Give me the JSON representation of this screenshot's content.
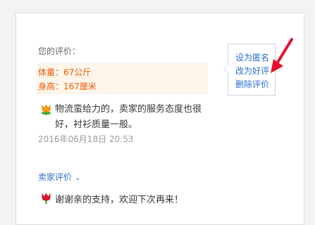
{
  "review": {
    "heading": "您的评价：",
    "attributes": [
      {
        "label": "体重：",
        "value": "67公斤"
      },
      {
        "label": "身高：",
        "value": "167厘米"
      }
    ],
    "text": "物流蛮给力的，卖家的服务态度也很好，衬衫质量一般。",
    "date": "2016年06月18日 20:53"
  },
  "menu": {
    "items": [
      "设为匿名",
      "改为好评",
      "删除评价"
    ]
  },
  "seller_section": {
    "label": "卖家评价",
    "reply": "谢谢亲的支持，欢迎下次再来！"
  },
  "colors": {
    "link": "#2a6ecf",
    "highlight_text": "#f05a00",
    "highlight_bg": "#fdf4ea",
    "annotation_arrow": "#e8102e"
  }
}
